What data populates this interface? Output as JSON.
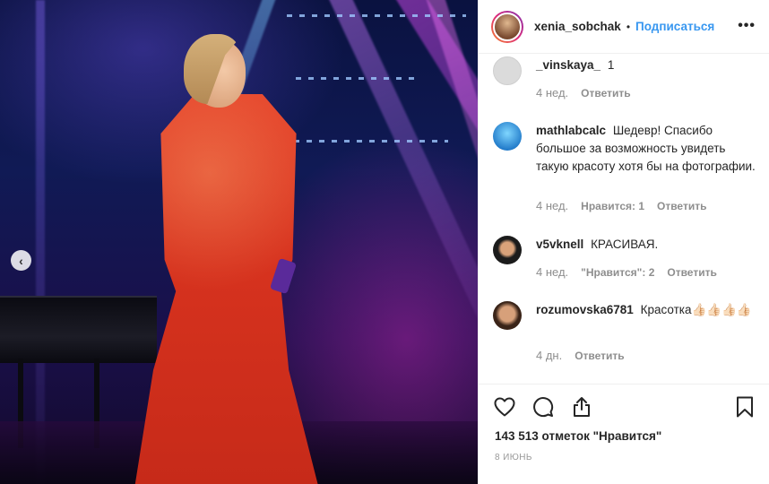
{
  "post": {
    "header": {
      "username": "xenia_sobchak",
      "separator": "•",
      "follow_label": "Подписаться",
      "more_label": "•••"
    },
    "comments": [
      {
        "username": "_vinskaya_",
        "text": "1",
        "time": "4 нед.",
        "likes": "",
        "reply_label": "Ответить"
      },
      {
        "username": "mathlabcalc",
        "text": "Шедевр! Спасибо большое за возможность увидеть такую красоту хотя бы на фотографии.",
        "time": "4 нед.",
        "likes": "Нравится: 1",
        "reply_label": "Ответить"
      },
      {
        "username": "v5vknell",
        "text": "КРАСИВАЯ.",
        "time": "4 нед.",
        "likes": "\"Нравится\": 2",
        "reply_label": "Ответить"
      },
      {
        "username": "rozumovska6781",
        "text": "Красотка👍🏻👍🏻👍🏻👍🏻",
        "time": "4 дн.",
        "likes": "",
        "reply_label": "Ответить"
      }
    ],
    "likes_text": "143 513 отметок \"Нравится\"",
    "date": "8 ИЮНЬ"
  },
  "carousel": {
    "prev_icon": "‹"
  },
  "colors": {
    "accent": "#3897f0",
    "muted": "#8e8e8e",
    "text": "#262626"
  }
}
